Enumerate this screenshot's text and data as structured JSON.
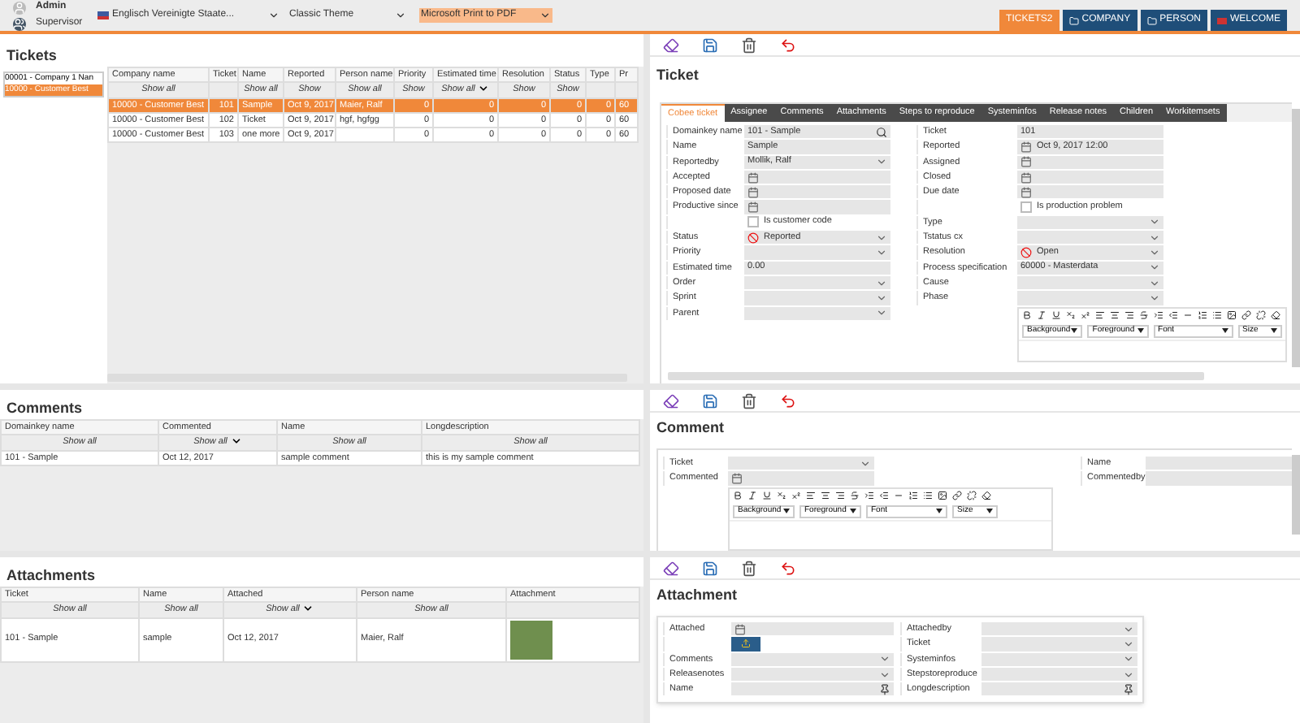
{
  "header": {
    "user": "Admin",
    "role": "Supervisor",
    "language": "Englisch Vereinigte Staate...",
    "theme": "Classic Theme",
    "printer": "Microsoft Print to PDF",
    "nav": [
      {
        "label": "TICKETS2",
        "selected": true,
        "kind": "plain"
      },
      {
        "label": "COMPANY",
        "selected": false,
        "kind": "folder"
      },
      {
        "label": "PERSON",
        "selected": false,
        "kind": "folder"
      },
      {
        "label": "WELCOME",
        "selected": false,
        "kind": "flag"
      }
    ]
  },
  "tickets": {
    "title": "Tickets",
    "companies": [
      {
        "label": "00001 - Company 1 Nan",
        "selected": false
      },
      {
        "label": "10000 - Customer Best",
        "selected": true
      }
    ],
    "columns": [
      {
        "label": "Company name",
        "filter": "Show all",
        "sorted": false,
        "kind": "text"
      },
      {
        "label": "Ticket",
        "sorted": false,
        "kind": "number"
      },
      {
        "label": "Name",
        "filter": "Show all",
        "sorted": false,
        "kind": "text"
      },
      {
        "label": "Reported",
        "filter": "Show",
        "sorted": false,
        "kind": "text"
      },
      {
        "label": "Person name",
        "filter": "Show all",
        "sorted": false,
        "kind": "text"
      },
      {
        "label": "Priority",
        "filter": "Show",
        "sorted": false,
        "kind": "number"
      },
      {
        "label": "Estimated time",
        "filter": "Show all",
        "sorted": true,
        "kind": "number"
      },
      {
        "label": "Resolution",
        "filter": "Show",
        "sorted": false,
        "kind": "number"
      },
      {
        "label": "Status",
        "filter": "Show",
        "sorted": false,
        "kind": "number"
      },
      {
        "label": "Type",
        "sorted": false,
        "kind": "number"
      },
      {
        "label": "Pr",
        "sorted": false,
        "kind": "text"
      }
    ],
    "rows": [
      {
        "cells": [
          "10000 - Customer Best",
          "101",
          "Sample",
          "Oct 9, 2017",
          "Maier, Ralf",
          "0",
          "0",
          "0",
          "0",
          "0",
          "60"
        ],
        "selected": true
      },
      {
        "cells": [
          "10000 - Customer Best",
          "102",
          "Ticket",
          "Oct 9, 2017",
          "hgf, hgfgg",
          "0",
          "0",
          "0",
          "0",
          "0",
          "60"
        ],
        "selected": false
      },
      {
        "cells": [
          "10000 - Customer Best",
          "103",
          "one more",
          "Oct 9, 2017",
          null,
          "0",
          "0",
          "0",
          "0",
          "0",
          "60"
        ],
        "selected": false
      }
    ]
  },
  "ticket_form": {
    "title": "Ticket",
    "tabs": [
      {
        "label": "Cobee ticket",
        "selected": true
      },
      {
        "label": "Assignee",
        "selected": false
      },
      {
        "label": "Comments",
        "selected": false
      },
      {
        "label": "Attachments",
        "selected": false
      },
      {
        "label": "Steps to reproduce",
        "selected": false
      },
      {
        "label": "Systeminfos",
        "selected": false
      },
      {
        "label": "Release notes",
        "selected": false
      },
      {
        "label": "Children",
        "selected": false
      },
      {
        "label": "Workitemsets",
        "selected": false
      }
    ],
    "left_fields": [
      {
        "label": "Domainkey name",
        "kind": "search",
        "value": "101 - Sample"
      },
      {
        "label": "Name",
        "kind": "text",
        "value": "Sample"
      },
      {
        "label": "Reportedby",
        "kind": "select",
        "value": "Mollik, Ralf"
      },
      {
        "label": "Accepted",
        "kind": "date"
      },
      {
        "label": "Proposed date",
        "kind": "date"
      },
      {
        "label": "Productive since",
        "kind": "date"
      },
      {
        "label": "Is customer code",
        "kind": "checkbox",
        "checked": false
      },
      {
        "label": "Status",
        "kind": "status",
        "value": "Reported"
      },
      {
        "label": "Priority",
        "kind": "select"
      },
      {
        "label": "Estimated time",
        "kind": "text",
        "value": "0.00"
      },
      {
        "label": "Order",
        "kind": "select"
      },
      {
        "label": "Sprint",
        "kind": "select"
      },
      {
        "label": "Parent",
        "kind": "select"
      }
    ],
    "right_fields": [
      {
        "label": "Ticket",
        "kind": "text",
        "value": "101"
      },
      {
        "label": "Reported",
        "kind": "date",
        "value": "Oct 9, 2017 12:00"
      },
      {
        "label": "Assigned",
        "kind": "date"
      },
      {
        "label": "Closed",
        "kind": "date"
      },
      {
        "label": "Due date",
        "kind": "date"
      },
      {
        "label": "Is production problem",
        "kind": "checkbox",
        "checked": false
      },
      {
        "label": "Type",
        "kind": "select"
      },
      {
        "label": "Tstatus cx",
        "kind": "select"
      },
      {
        "label": "Resolution",
        "kind": "status",
        "value": "Open"
      },
      {
        "label": "Process specification",
        "kind": "select",
        "value": "60000 - Masterdata"
      },
      {
        "label": "Cause",
        "kind": "select"
      },
      {
        "label": "Phase",
        "kind": "select"
      }
    ],
    "editor": {
      "dropdowns": [
        "Background",
        "Foreground",
        "Font",
        "Size"
      ]
    }
  },
  "comments": {
    "title": "Comments",
    "columns": [
      {
        "label": "Domainkey name",
        "filter": "Show all",
        "sorted": false,
        "kind": "text"
      },
      {
        "label": "Commented",
        "filter": "Show all",
        "sorted": true,
        "kind": "text"
      },
      {
        "label": "Name",
        "filter": "Show all",
        "sorted": false,
        "kind": "text"
      },
      {
        "label": "Longdescription",
        "filter": "Show all",
        "sorted": false,
        "kind": "text"
      }
    ],
    "rows": [
      {
        "cells": [
          "101 - Sample",
          "Oct 12, 2017",
          "sample comment",
          "this is my sample comment"
        ],
        "selected": false
      }
    ]
  },
  "comment_form": {
    "title": "Comment",
    "left_fields": [
      {
        "label": "Ticket",
        "kind": "select"
      },
      {
        "label": "Commented",
        "kind": "date"
      }
    ],
    "right_fields": [
      {
        "label": "Name",
        "kind": "text"
      },
      {
        "label": "Commentedby",
        "kind": "text"
      }
    ],
    "editor": {
      "dropdowns": [
        "Background",
        "Foreground",
        "Font",
        "Size"
      ]
    }
  },
  "attachments": {
    "title": "Attachments",
    "columns": [
      {
        "label": "Ticket",
        "filter": "Show all",
        "sorted": false,
        "kind": "text"
      },
      {
        "label": "Name",
        "filter": "Show all",
        "sorted": false,
        "kind": "text"
      },
      {
        "label": "Attached",
        "filter": "Show all",
        "sorted": true,
        "kind": "text"
      },
      {
        "label": "Person name",
        "filter": "Show all",
        "sorted": false,
        "kind": "text"
      },
      {
        "label": "Attachment",
        "sorted": false,
        "kind": "image"
      }
    ],
    "rows": [
      {
        "cells": [
          "101 - Sample",
          "sample",
          "Oct 12, 2017",
          "Maier, Ralf"
        ],
        "selected": false
      }
    ]
  },
  "attachment_form": {
    "title": "Attachment",
    "left_fields": [
      {
        "label": "Attached",
        "kind": "date"
      },
      {
        "kind": "upload"
      },
      {
        "label": "Comments",
        "kind": "select"
      },
      {
        "label": "Releasenotes",
        "kind": "select"
      },
      {
        "label": "Name",
        "kind": "pin"
      }
    ],
    "right_fields": [
      {
        "label": "Attachedby",
        "kind": "select"
      },
      {
        "label": "Ticket",
        "kind": "select"
      },
      {
        "label": "Systeminfos",
        "kind": "select"
      },
      {
        "label": "Stepstoreproduce",
        "kind": "select"
      },
      {
        "label": "Longdescription",
        "kind": "pin"
      }
    ]
  }
}
